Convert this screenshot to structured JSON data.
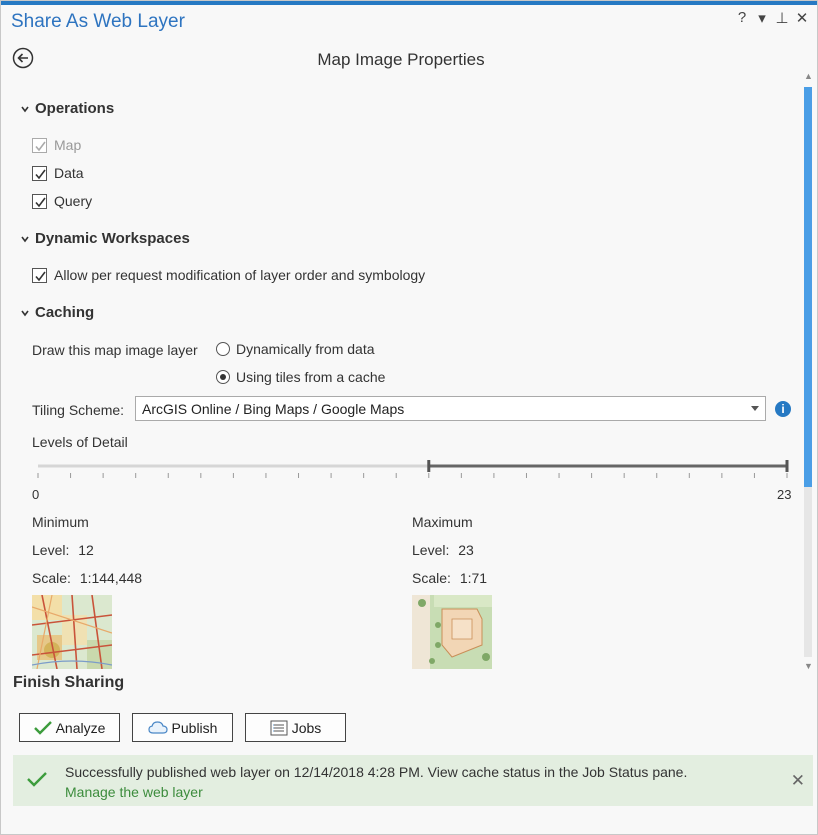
{
  "window": {
    "title": "Share As Web Layer",
    "help": "?",
    "menu": "▾",
    "pin": "⊥",
    "close": "✕"
  },
  "page_title": "Map Image Properties",
  "operations": {
    "heading": "Operations",
    "items": [
      {
        "label": "Map",
        "checked": true,
        "disabled": true
      },
      {
        "label": "Data",
        "checked": true,
        "disabled": false
      },
      {
        "label": "Query",
        "checked": true,
        "disabled": false
      }
    ]
  },
  "dynamic_workspaces": {
    "heading": "Dynamic Workspaces",
    "allow_label": "Allow per request modification of layer order and symbology"
  },
  "caching": {
    "heading": "Caching",
    "draw_label": "Draw this map image layer",
    "radio_dynamic": "Dynamically from data",
    "radio_cache": "Using tiles from a cache",
    "selected": "cache",
    "tiling_label": "Tiling Scheme:",
    "tiling_value": "ArcGIS Online / Bing Maps / Google Maps",
    "lod_label": "Levels of Detail",
    "slider": {
      "min": "0",
      "max": "23",
      "low": 12,
      "high": 23
    },
    "minimum": {
      "heading": "Minimum",
      "level_label": "Level:",
      "level": "12",
      "scale_label": "Scale:",
      "scale": "1:144,448"
    },
    "maximum": {
      "heading": "Maximum",
      "level_label": "Level:",
      "level": "23",
      "scale_label": "Scale:",
      "scale": "1:71"
    }
  },
  "finish": {
    "heading": "Finish Sharing",
    "analyze": "Analyze",
    "publish": "Publish",
    "jobs": "Jobs"
  },
  "status": {
    "message": "Successfully published web layer on 12/14/2018 4:28 PM. View cache status in the Job Status pane.",
    "link": "Manage the web layer"
  },
  "colors": {
    "accent": "#2679c3",
    "success": "#3c8c3c",
    "status_bg": "#e3eee0"
  }
}
